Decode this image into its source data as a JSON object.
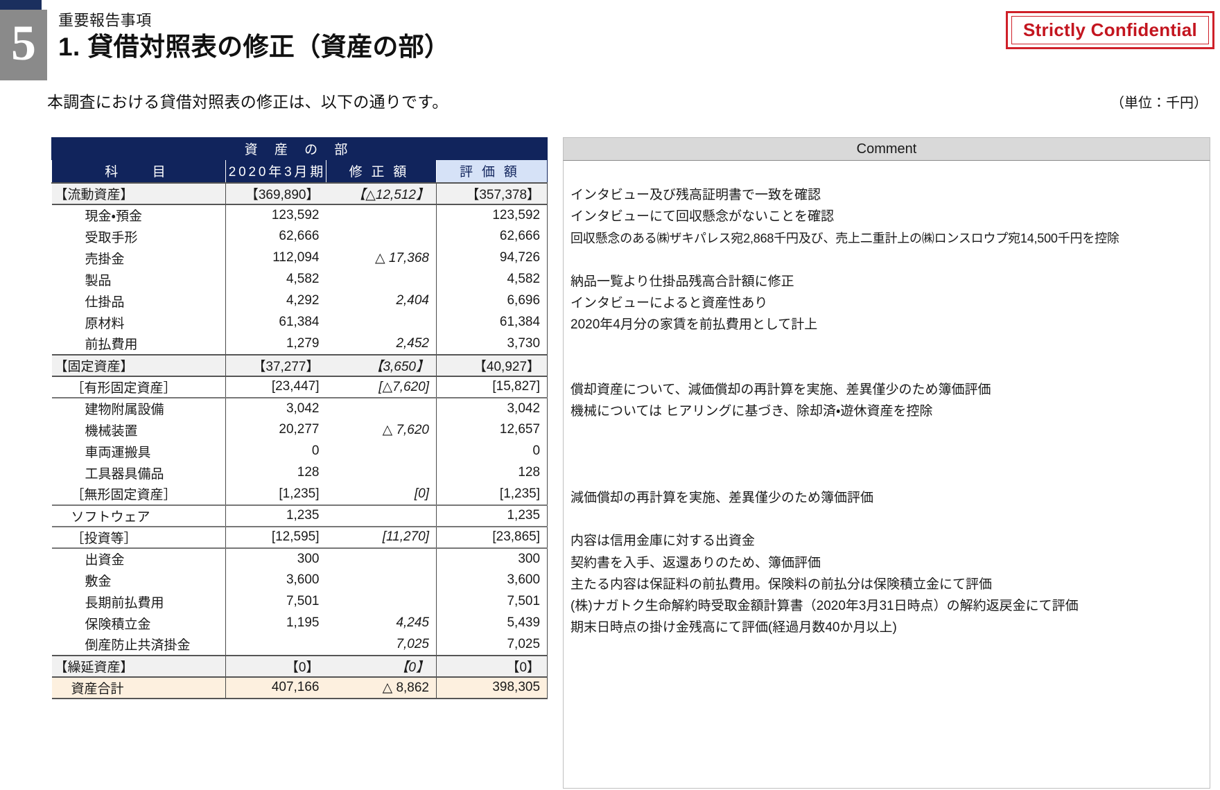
{
  "header": {
    "slide_number": "5",
    "kicker": "重要報告事項",
    "title": "1. 貸借対照表の修正（資産の部）",
    "confidential_badge": "Strictly Confidential",
    "lead": "本調査における貸借対照表の修正は、以下の通りです。",
    "unit_note": "（単位：千円）",
    "accent_navy": "#11245c",
    "accent_gray": "#8a8a8a",
    "confidential_red": "#c3151f"
  },
  "balance_sheet": {
    "section_title": "資 産 の 部",
    "columns": [
      "科　　目",
      "2020年3月期",
      "修 正 額",
      "評 価 額"
    ],
    "rows": [
      {
        "style": "group",
        "item": "【流動資産】",
        "base": "【369,890】",
        "adj": "【△12,512】",
        "eval": "【357,378】"
      },
      {
        "style": "leaf",
        "item": "現金・預金",
        "base": "123,592",
        "adj": "",
        "eval": "123,592"
      },
      {
        "style": "leaf",
        "item": "受取手形",
        "base": "62,666",
        "adj": "",
        "eval": "62,666"
      },
      {
        "style": "leaf",
        "item": "売掛金",
        "base": "112,094",
        "adj": "△ 17,368",
        "eval": "94,726"
      },
      {
        "style": "leaf",
        "item": "製品",
        "base": "4,582",
        "adj": "",
        "eval": "4,582"
      },
      {
        "style": "leaf",
        "item": "仕掛品",
        "base": "4,292",
        "adj": "2,404",
        "eval": "6,696"
      },
      {
        "style": "leaf",
        "item": "原材料",
        "base": "61,384",
        "adj": "",
        "eval": "61,384"
      },
      {
        "style": "leaf",
        "item": "前払費用",
        "base": "1,279",
        "adj": "2,452",
        "eval": "3,730"
      },
      {
        "style": "group",
        "item": "【固定資産】",
        "base": "【37,277】",
        "adj": "【3,650】",
        "eval": "【40,927】"
      },
      {
        "style": "sub",
        "item": "［有形固定資産］",
        "base": "[23,447]",
        "adj": "[△7,620]",
        "eval": "[15,827]"
      },
      {
        "style": "leaf",
        "item": "建物附属設備",
        "base": "3,042",
        "adj": "",
        "eval": "3,042"
      },
      {
        "style": "leaf",
        "item": "機械装置",
        "base": "20,277",
        "adj": "△ 7,620",
        "eval": "12,657"
      },
      {
        "style": "leaf",
        "item": "車両運搬具",
        "base": "0",
        "adj": "",
        "eval": "0"
      },
      {
        "style": "leaf",
        "item": "工具器具備品",
        "base": "128",
        "adj": "",
        "eval": "128"
      },
      {
        "style": "sub",
        "item": "［無形固定資産］",
        "base": "[1,235]",
        "adj": "[0]",
        "eval": "[1,235]"
      },
      {
        "style": "sub",
        "item": "ソフトウェア",
        "base": "1,235",
        "adj": "",
        "eval": "1,235"
      },
      {
        "style": "sub",
        "item": "［投資等］",
        "base": "[12,595]",
        "adj": "[11,270]",
        "eval": "[23,865]"
      },
      {
        "style": "leaf",
        "item": "出資金",
        "base": "300",
        "adj": "",
        "eval": "300"
      },
      {
        "style": "leaf",
        "item": "敷金",
        "base": "3,600",
        "adj": "",
        "eval": "3,600"
      },
      {
        "style": "leaf",
        "item": "長期前払費用",
        "base": "7,501",
        "adj": "",
        "eval": "7,501"
      },
      {
        "style": "leaf",
        "item": "保険積立金",
        "base": "1,195",
        "adj": "4,245",
        "eval": "5,439"
      },
      {
        "style": "leaf",
        "item": "倒産防止共済掛金",
        "base": "",
        "adj": "7,025",
        "eval": "7,025"
      },
      {
        "style": "group",
        "item": "【繰延資産】",
        "base": "【0】",
        "adj": "【0】",
        "eval": "【0】"
      },
      {
        "style": "total",
        "item": "資産合計",
        "base": "407,166",
        "adj": "△ 8,862",
        "eval": "398,305"
      }
    ]
  },
  "comments": {
    "header": "Comment",
    "lines": [
      {
        "row": 1,
        "text": "インタビュー及び残高証明書で一致を確認",
        "small": false
      },
      {
        "row": 2,
        "text": "インタビューにて回収懸念がないことを確認",
        "small": false
      },
      {
        "row": 3,
        "text": "回収懸念のある㈱ザキパレス宛2,868千円及び、売上二重計上の㈱ロンスロウプ宛14,500千円を控除",
        "small": true
      },
      {
        "row": 5,
        "text": "納品一覧より仕掛品残高合計額に修正",
        "small": false
      },
      {
        "row": 6,
        "text": "インタビューによると資産性あり",
        "small": false
      },
      {
        "row": 7,
        "text": "2020年4月分の家賃を前払費用として計上",
        "small": false
      },
      {
        "row": 10,
        "text": "償却資産について、減価償却の再計算を実施、差異僅少のため簿価評価",
        "small": false
      },
      {
        "row": 11,
        "text": "機械については ヒアリングに基づき、除却済・遊休資産を控除",
        "small": false
      },
      {
        "row": 15,
        "text": "減価償却の再計算を実施、差異僅少のため簿価評価",
        "small": false
      },
      {
        "row": 17,
        "text": "内容は信用金庫に対する出資金",
        "small": false
      },
      {
        "row": 18,
        "text": "契約書を入手、返還ありのため、簿価評価",
        "small": false
      },
      {
        "row": 19,
        "text": "主たる内容は保証料の前払費用。保険料の前払分は保険積立金にて評価",
        "small": false
      },
      {
        "row": 20,
        "text": "(株)ナガトク生命解約時受取金額計算書（2020年3月31日時点）の解約返戻金にて評価",
        "small": false
      },
      {
        "row": 21,
        "text": "期末日時点の掛け金残高にて評価(経過月数40か月以上)",
        "small": false
      }
    ]
  }
}
